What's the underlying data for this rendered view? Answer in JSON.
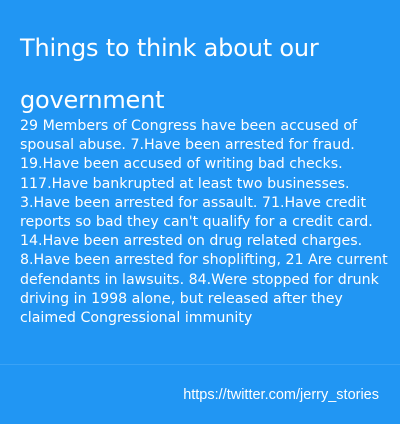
{
  "card": {
    "title": "Things to think about our government",
    "body": "29 Members of Congress have been accused of spousal abuse. 7.Have been arrested for fraud. 19.Have been accused of writing bad checks. 117.Have bankrupted at least two businesses. 3.Have been arrested for assault. 71.Have credit reports so bad they can't qualify for a credit card. 14.Have been arrested on drug related charges. 8.Have been arrested for shoplifting, 21 Are current defendants in lawsuits. 84.Were stopped for drunk driving in 1998 alone, but released after they claimed Congressional immunity",
    "link": "https://twitter.com/jerry_stories"
  },
  "colors": {
    "background": "#2196f3",
    "text": "#ffffff"
  }
}
